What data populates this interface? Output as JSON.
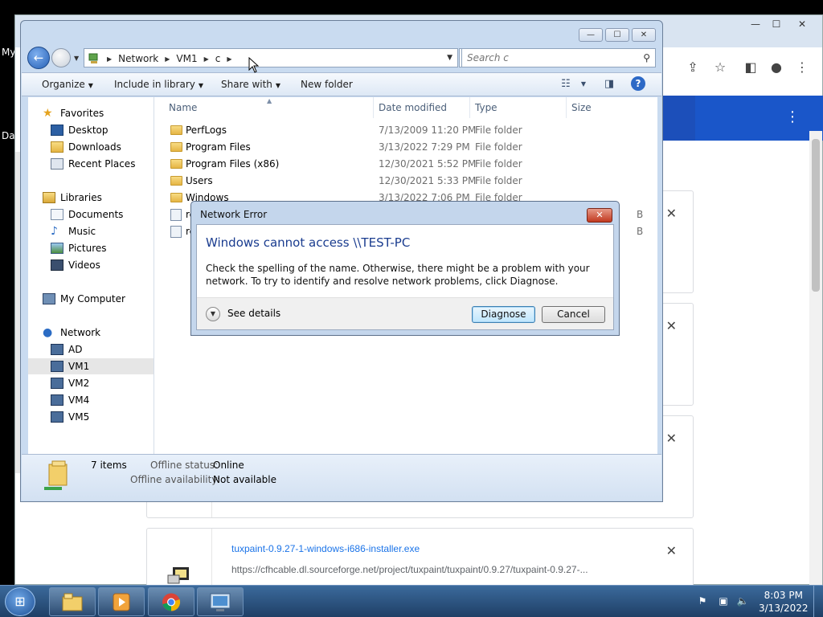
{
  "desktop": {
    "icon_label_1": "My",
    "icon_label_2": "Dat"
  },
  "chrome": {
    "window_buttons": [
      "—",
      "☐",
      "✕"
    ],
    "downloads": [
      {
        "name": "",
        "url": ""
      },
      {
        "name": "",
        "url": ""
      },
      {
        "name": "",
        "url": ""
      },
      {
        "name": "tuxpaint-0.9.27-1-windows-i686-installer.exe",
        "url": "https://cfhcable.dl.sourceforge.net/project/tuxpaint/tuxpaint/0.9.27/tuxpaint-0.9.27-..."
      }
    ]
  },
  "explorer": {
    "window_buttons": [
      "—",
      "☐",
      "✕"
    ],
    "breadcrumbs": [
      "Network",
      "VM1",
      "c"
    ],
    "search_placeholder": "Search c",
    "commands": {
      "organize": "Organize",
      "include_in_library": "Include in library",
      "share_with": "Share with",
      "new_folder": "New folder"
    },
    "nav": {
      "favorites": "Favorites",
      "desktop": "Desktop",
      "downloads": "Downloads",
      "recent_places": "Recent Places",
      "libraries": "Libraries",
      "documents": "Documents",
      "music": "Music",
      "pictures": "Pictures",
      "videos": "Videos",
      "my_computer": "My Computer",
      "network": "Network",
      "ad": "AD",
      "vm1": "VM1",
      "vm2": "VM2",
      "vm4": "VM4",
      "vm5": "VM5"
    },
    "columns": {
      "name": "Name",
      "date_modified": "Date modified",
      "type": "Type",
      "size": "Size"
    },
    "rows": [
      {
        "name": "PerfLogs",
        "date": "7/13/2009 11:20 PM",
        "type": "File folder",
        "size": ""
      },
      {
        "name": "Program Files",
        "date": "3/13/2022 7:29 PM",
        "type": "File folder",
        "size": ""
      },
      {
        "name": "Program Files (x86)",
        "date": "12/30/2021 5:52 PM",
        "type": "File folder",
        "size": ""
      },
      {
        "name": "Users",
        "date": "12/30/2021 5:33 PM",
        "type": "File folder",
        "size": ""
      },
      {
        "name": "Windows",
        "date": "3/13/2022 7:06 PM",
        "type": "File folder",
        "size": ""
      },
      {
        "name": "re",
        "date": "",
        "type": "",
        "size": "B"
      },
      {
        "name": "re",
        "date": "",
        "type": "",
        "size": "B"
      }
    ],
    "status": {
      "item_count": "7 items",
      "offline_status_label": "Offline status:",
      "offline_status_value": "Online",
      "offline_availability_label": "Offline availability:",
      "offline_availability_value": "Not available"
    }
  },
  "dialog": {
    "title": "Network Error",
    "close_label": "✕",
    "heading": "Windows cannot access \\\\TEST-PC",
    "message": "Check the spelling of the name. Otherwise, there might be a problem with your network. To try to identify and resolve network problems, click Diagnose.",
    "see_details": "See details",
    "diagnose_button": "Diagnose",
    "cancel_button": "Cancel"
  },
  "taskbar": {
    "clock_time": "8:03 PM",
    "clock_date": "3/13/2022"
  }
}
